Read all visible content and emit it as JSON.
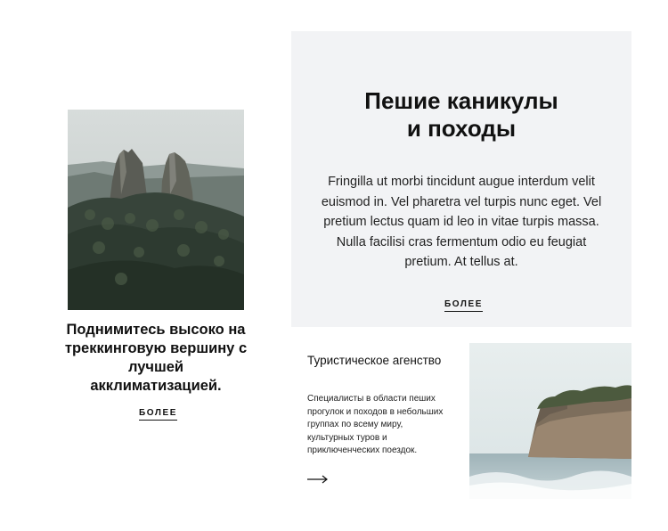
{
  "left_card": {
    "image_alt": "mountain-peaks",
    "heading": "Поднимитесь высоко на треккинговую вершину с лучшей акклиматизацией.",
    "more_label": "БОЛЕЕ"
  },
  "feature": {
    "title_line1": "Пешие каникулы",
    "title_line2": "и походы",
    "text": "Fringilla ut morbi tincidunt augue interdum velit euismod in. Vel pharetra vel turpis nunc eget. Vel pretium lectus quam id leo in vitae turpis massa. Nulla facilisi cras fermentum odio eu feugiat pretium. At tellus at.",
    "more_label": "БОЛЕЕ"
  },
  "agency": {
    "title": "Туристическое агенство",
    "text": "Специалисты в области пеших прогулок и походов в небольших группах по всему миру, культурных туров и приключенческих поездок.",
    "arrow_icon": "arrow-right-icon"
  },
  "colors": {
    "panel_bg": "#f2f3f5",
    "text": "#111111"
  }
}
